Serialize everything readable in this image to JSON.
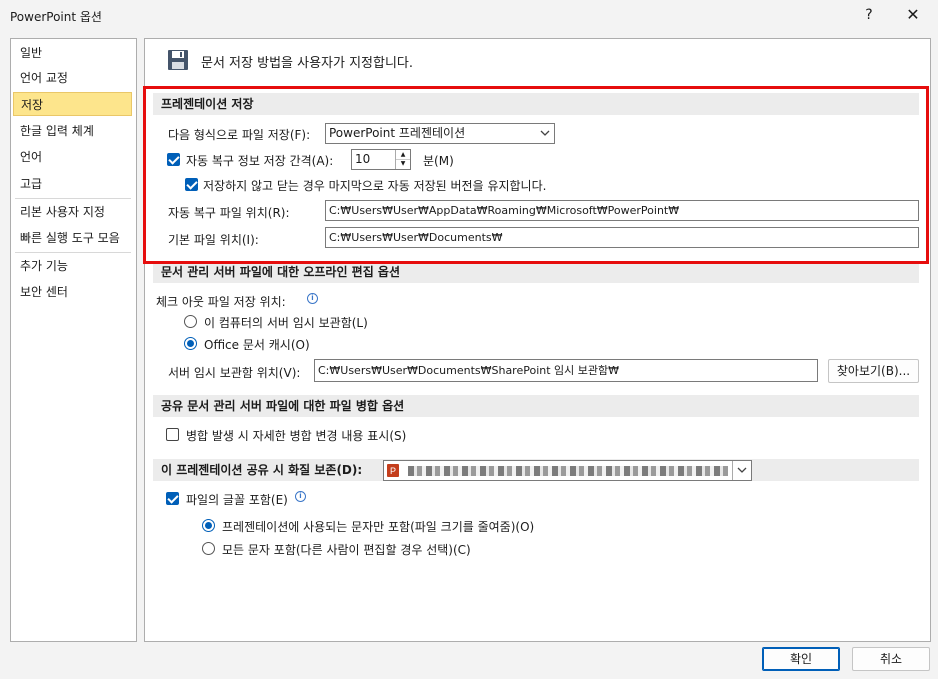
{
  "window": {
    "title": "PowerPoint 옵션",
    "help": "?",
    "close": "✕"
  },
  "sidebar": {
    "items": [
      {
        "label": "일반"
      },
      {
        "label": "언어 교정"
      },
      {
        "label": "저장"
      },
      {
        "label": "한글 입력 체계"
      },
      {
        "label": "언어"
      },
      {
        "label": "고급"
      },
      {
        "label": "리본 사용자 지정"
      },
      {
        "label": "빠른 실행 도구 모음"
      },
      {
        "label": "추가 기능"
      },
      {
        "label": "보안 센터"
      }
    ],
    "active_index": 2
  },
  "header": {
    "icon": "save-icon",
    "text": "문서 저장 방법을 사용자가 지정합니다."
  },
  "save_section": {
    "title": "프레젠테이션 저장",
    "format_label": "다음 형식으로 파일 저장(F):",
    "format_value": "PowerPoint 프레젠테이션",
    "autorecover_label": "자동 복구 정보 저장 간격(A):",
    "autorecover_checked": true,
    "autorecover_minutes": "10",
    "minutes_unit": "분(M)",
    "keep_last_label": "저장하지 않고 닫는 경우 마지막으로 자동 저장된 버전을 유지합니다.",
    "keep_last_checked": true,
    "autorecover_location_label": "자동 복구 파일 위치(R):",
    "autorecover_location_value": "C:₩Users₩User₩AppData₩Roaming₩Microsoft₩PowerPoint₩",
    "default_location_label": "기본 파일 위치(I):",
    "default_location_value": "C:₩Users₩User₩Documents₩"
  },
  "offline_section": {
    "title": "문서 관리 서버 파일에 대한 오프라인 편집 옵션",
    "checkout_label": "체크 아웃 파일 저장 위치:",
    "option_computer": "이 컴퓨터의 서버 임시 보관함(L)",
    "option_cache": "Office 문서 캐시(O)",
    "selected": "cache",
    "drafts_label": "서버 임시 보관함 위치(V):",
    "drafts_value": "C:₩Users₩User₩Documents₩SharePoint 임시 보관함₩",
    "browse_label": "찾아보기(B)..."
  },
  "merge_section": {
    "title": "공유 문서 관리 서버 파일에 대한 파일 병합 옵션",
    "show_changes_label": "병합 발생 시 자세한 병합 변경 내용 표시(S)",
    "show_changes_checked": false
  },
  "fidelity_section": {
    "title": "이 프레젠테이션 공유 시 화질 보존(D):",
    "embed_fonts_label": "파일의 글꼴 포함(E)",
    "embed_fonts_checked": true,
    "option_used_chars": "프레젠테이션에 사용되는 문자만 포함(파일 크기를 줄여줌)(O)",
    "option_all_chars": "모든 문자 포함(다른 사람이 편집할 경우 선택)(C)",
    "selected": "used_chars"
  },
  "footer": {
    "ok_label": "확인",
    "cancel_label": "취소"
  },
  "colors": {
    "accent": "#005fb8",
    "highlight": "#e60d0d",
    "nav_active": "#fde58c"
  }
}
